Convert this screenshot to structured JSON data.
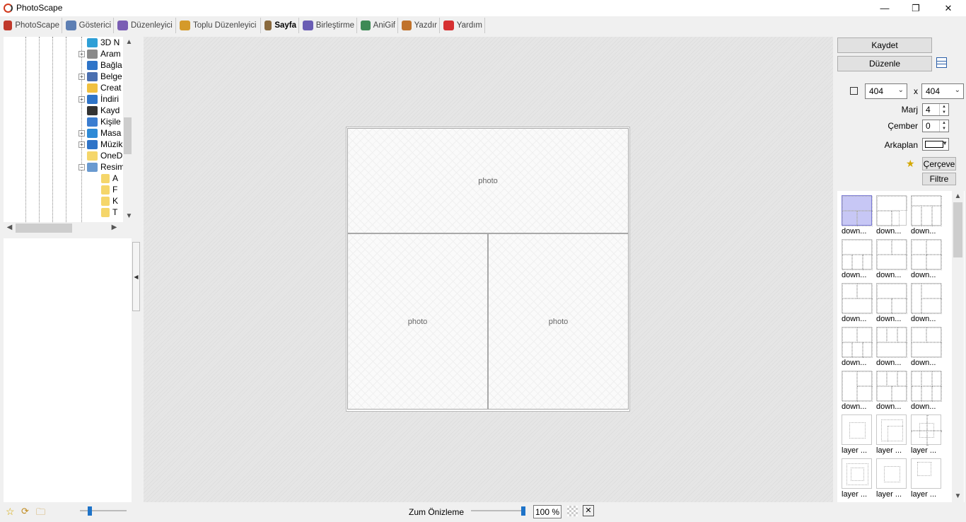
{
  "window": {
    "title": "PhotoScape",
    "minimize": "—",
    "maximize": "❐",
    "close": "✕"
  },
  "tabs": [
    {
      "label": "PhotoScape",
      "color": "#c0392b"
    },
    {
      "label": "Gösterici",
      "color": "#5d7fb4"
    },
    {
      "label": "Düzenleyici",
      "color": "#7a5db4"
    },
    {
      "label": "Toplu Düzenleyici",
      "color": "#d49a2a"
    },
    {
      "label": "Sayfa",
      "color": "#8a6a3e"
    },
    {
      "label": "Birleştirme",
      "color": "#6a5db4"
    },
    {
      "label": "AniGif",
      "color": "#3e8a55"
    },
    {
      "label": "Yazdır",
      "color": "#c0722b"
    },
    {
      "label": "Yardım",
      "color": "#d63031"
    }
  ],
  "active_tab": "Sayfa",
  "tree": {
    "items": [
      {
        "label": "3D N",
        "expand": "",
        "color": "#2e9fd6"
      },
      {
        "label": "Aram",
        "expand": "+",
        "color": "#8a8a8a"
      },
      {
        "label": "Bağla",
        "expand": "",
        "color": "#2e74c8"
      },
      {
        "label": "Belge",
        "expand": "+",
        "color": "#4a6fb0"
      },
      {
        "label": "Creat",
        "expand": "",
        "color": "#f0c040"
      },
      {
        "label": "İndiri",
        "expand": "+",
        "color": "#2e74c8"
      },
      {
        "label": "Kayd",
        "expand": "",
        "color": "#333333"
      },
      {
        "label": "Kişile",
        "expand": "",
        "color": "#3b7dd0"
      },
      {
        "label": "Masa",
        "expand": "+",
        "color": "#2e8ad6"
      },
      {
        "label": "Müzik",
        "expand": "+",
        "color": "#2e74c8"
      },
      {
        "label": "OneD",
        "expand": "",
        "color": "#f5d66a"
      },
      {
        "label": "Resim",
        "expand": "−",
        "color": "#6a9ad0"
      }
    ],
    "sub_items": [
      "A",
      "F",
      "K",
      "T"
    ]
  },
  "right_panel": {
    "save_label": "Kaydet",
    "edit_label": "Düzenle",
    "width_value": "404",
    "height_value": "404",
    "x_label": "x",
    "margin_label": "Marj",
    "margin_value": "4",
    "circle_label": "Çember",
    "circle_value": "0",
    "background_label": "Arkaplan",
    "frame_label": "Çerçeve",
    "filter_label": "Filtre"
  },
  "page": {
    "cell_label": "photo"
  },
  "templates": [
    "down...",
    "down...",
    "down...",
    "down...",
    "down...",
    "down...",
    "down...",
    "down...",
    "down...",
    "down...",
    "down...",
    "down...",
    "down...",
    "down...",
    "down...",
    "layer ...",
    "layer ...",
    "layer ...",
    "layer ...",
    "layer ...",
    "layer ..."
  ],
  "status": {
    "zoom_label": "Zum Önizleme",
    "zoom_value": "100 %"
  }
}
